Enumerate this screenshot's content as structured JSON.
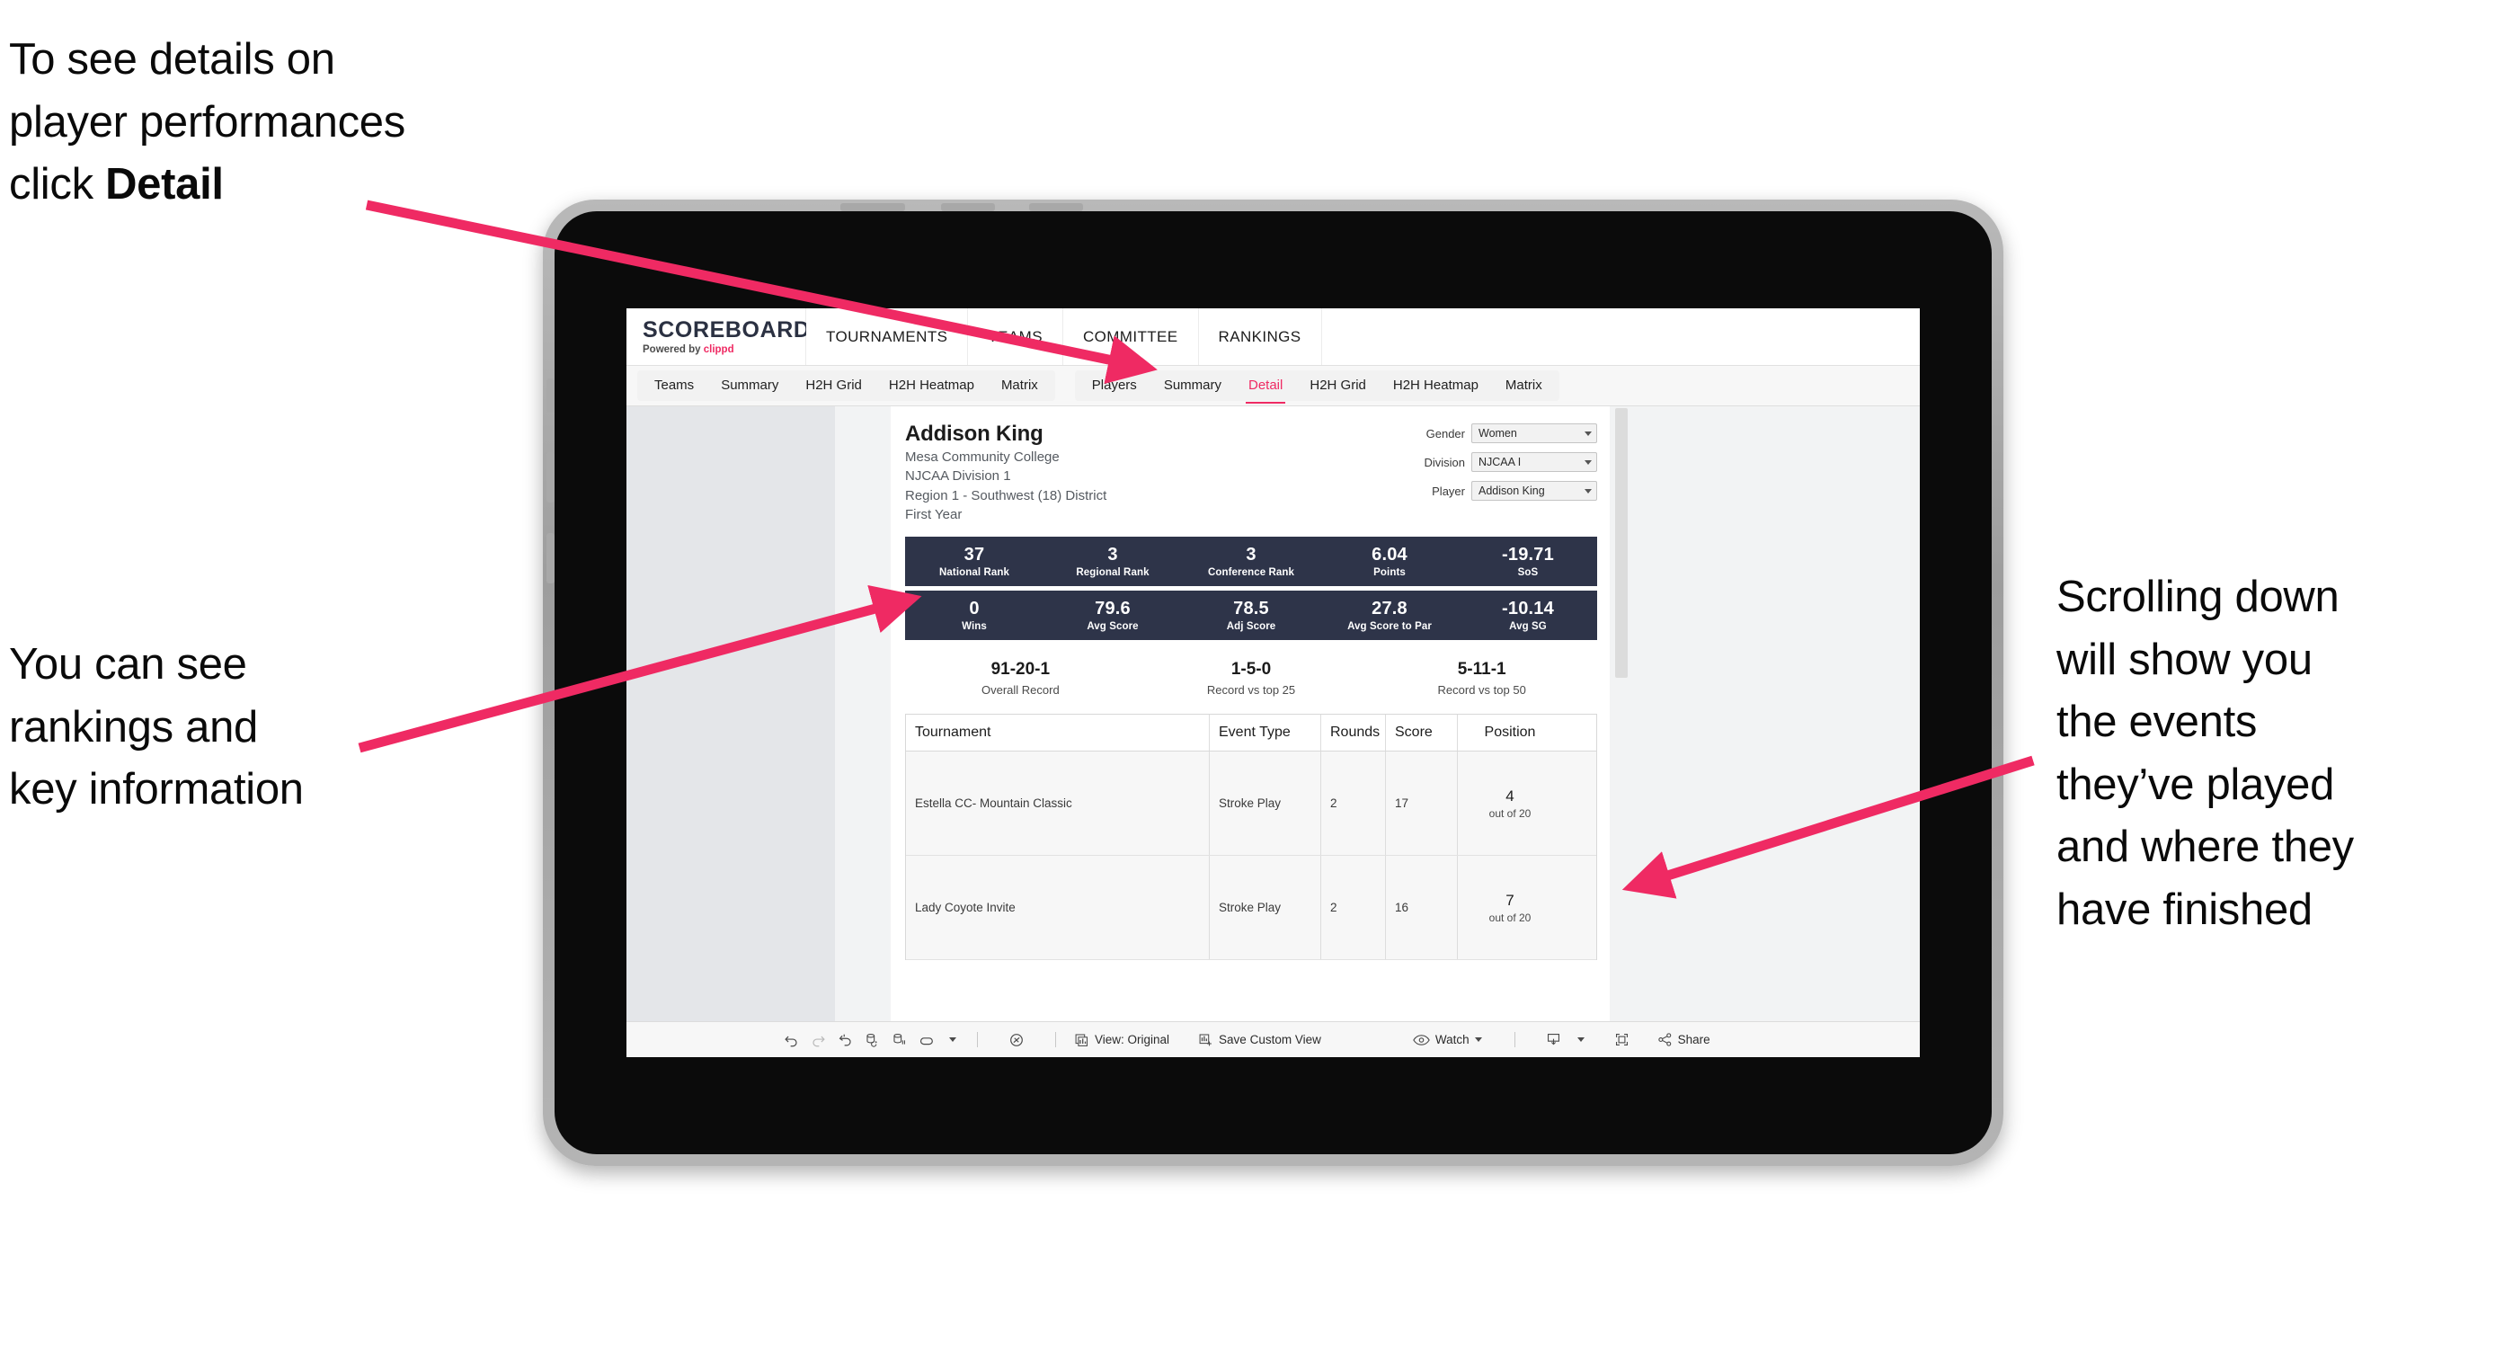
{
  "annotations": {
    "top_left": {
      "line1": "To see details on",
      "line2": "player performances",
      "line3_prefix": "click ",
      "line3_bold": "Detail"
    },
    "mid_left": {
      "line1": "You can see",
      "line2": "rankings and",
      "line3": "key information"
    },
    "right": {
      "line1": "Scrolling down",
      "line2": "will show you",
      "line3": "the events",
      "line4": "they’ve played",
      "line5": "and where they",
      "line6": "have finished"
    },
    "arrow_color": "#ef2a63"
  },
  "app": {
    "brand": {
      "title": "SCOREBOARD",
      "powered_prefix": "Powered by ",
      "powered_name": "clippd"
    },
    "top_nav": [
      {
        "label": "TOURNAMENTS"
      },
      {
        "label": "TEAMS"
      },
      {
        "label": "COMMITTEE"
      },
      {
        "label": "RANKINGS"
      }
    ],
    "sub_nav": {
      "group_teams": [
        {
          "label": "Teams",
          "active": false
        },
        {
          "label": "Summary",
          "active": false
        },
        {
          "label": "H2H Grid",
          "active": false
        },
        {
          "label": "H2H Heatmap",
          "active": false
        },
        {
          "label": "Matrix",
          "active": false
        }
      ],
      "group_players": [
        {
          "label": "Players",
          "active": false
        },
        {
          "label": "Summary",
          "active": false
        },
        {
          "label": "Detail",
          "active": true
        },
        {
          "label": "H2H Grid",
          "active": false
        },
        {
          "label": "H2H Heatmap",
          "active": false
        },
        {
          "label": "Matrix",
          "active": false
        }
      ]
    },
    "player": {
      "name": "Addison King",
      "school": "Mesa Community College",
      "division": "NJCAA Division 1",
      "region": "Region 1 - Southwest (18) District",
      "year": "First Year"
    },
    "selectors": [
      {
        "label": "Gender",
        "value": "Women"
      },
      {
        "label": "Division",
        "value": "NJCAA I"
      },
      {
        "label": "Player",
        "value": "Addison King"
      }
    ],
    "stats_row_1": [
      {
        "value": "37",
        "label": "National Rank"
      },
      {
        "value": "3",
        "label": "Regional Rank"
      },
      {
        "value": "3",
        "label": "Conference Rank"
      },
      {
        "value": "6.04",
        "label": "Points"
      },
      {
        "value": "-19.71",
        "label": "SoS"
      }
    ],
    "stats_row_2": [
      {
        "value": "0",
        "label": "Wins"
      },
      {
        "value": "79.6",
        "label": "Avg Score"
      },
      {
        "value": "78.5",
        "label": "Adj Score"
      },
      {
        "value": "27.8",
        "label": "Avg Score to Par"
      },
      {
        "value": "-10.14",
        "label": "Avg SG"
      }
    ],
    "records": [
      {
        "value": "91-20-1",
        "label": "Overall Record"
      },
      {
        "value": "1-5-0",
        "label": "Record vs top 25"
      },
      {
        "value": "5-11-1",
        "label": "Record vs top 50"
      }
    ],
    "table": {
      "headers": {
        "tournament": "Tournament",
        "event_type": "Event Type",
        "rounds": "Rounds",
        "score": "Score",
        "position": "Position"
      },
      "rows": [
        {
          "tournament": "Estella CC- Mountain Classic",
          "event_type": "Stroke Play",
          "rounds": "2",
          "score": "17",
          "position_main": "4",
          "position_sub": "out of 20"
        },
        {
          "tournament": "Lady Coyote Invite",
          "event_type": "Stroke Play",
          "rounds": "2",
          "score": "16",
          "position_main": "7",
          "position_sub": "out of 20"
        }
      ]
    },
    "toolbar": {
      "view_label": "View: Original",
      "save_custom_view_label": "Save Custom View",
      "watch_label": "Watch",
      "share_label": "Share"
    },
    "accent_color": "#ef2a63",
    "stat_bar_color": "#2e3449"
  }
}
